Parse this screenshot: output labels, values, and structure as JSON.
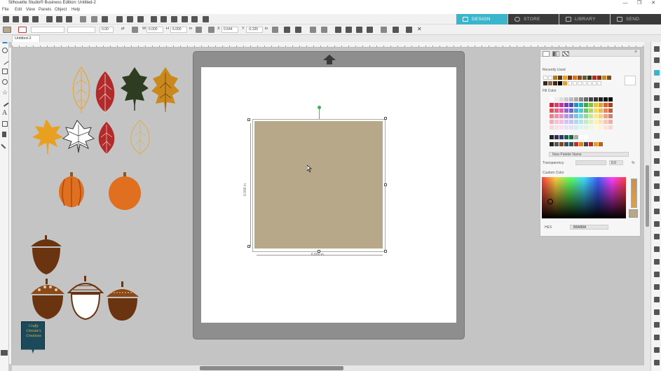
{
  "window": {
    "title": "Silhouette Studio® Business Edition: Untitled-2",
    "minimize": "—",
    "maximize": "❐",
    "close": "✕"
  },
  "menu": [
    "File",
    "Edit",
    "View",
    "Panels",
    "Object",
    "Help"
  ],
  "nav_tabs": [
    {
      "label": "DESIGN",
      "active": true
    },
    {
      "label": "STORE",
      "active": false
    },
    {
      "label": "LIBRARY",
      "active": false
    },
    {
      "label": "SEND",
      "active": false
    }
  ],
  "toolbar2": {
    "line_width": "0.00",
    "line_unit": "pt",
    "w_label": "W",
    "w_value": "6.000",
    "h_label": "H",
    "h_value": "6.000",
    "unit": "in",
    "x_label": "X",
    "x_value": "0.544",
    "y_label": "Y",
    "y_value": "-0.335",
    "xy_unit": "in"
  },
  "document_tab": "Untitled-2",
  "selection": {
    "width_label": "6.000 in",
    "height_label": "6.000 in",
    "fill_color": "#b8a88a"
  },
  "panel": {
    "title": "Fill",
    "recently_used": "Recently Used",
    "fill_color": "Fill Color",
    "new_palette": "New Palette Name",
    "transparency_label": "Transparency",
    "transparency_value": "0.0",
    "transparency_unit": "%",
    "custom_color": "Custom Color",
    "hex_label": "HEX",
    "hex_value": "B8A88A"
  },
  "logo": {
    "text": "Crafty Christie's Creations"
  },
  "colors": {
    "accent": "#39b5cc",
    "workspace": "#c4c4c4",
    "mat": "#8e8e8e",
    "leaf_gold": "#e8a63a",
    "leaf_red": "#b22a2a",
    "leaf_green": "#2e3d22",
    "leaf_orange": "#e07a1a",
    "pumpkin": "#e07020",
    "acorn_brown": "#6b3410"
  }
}
